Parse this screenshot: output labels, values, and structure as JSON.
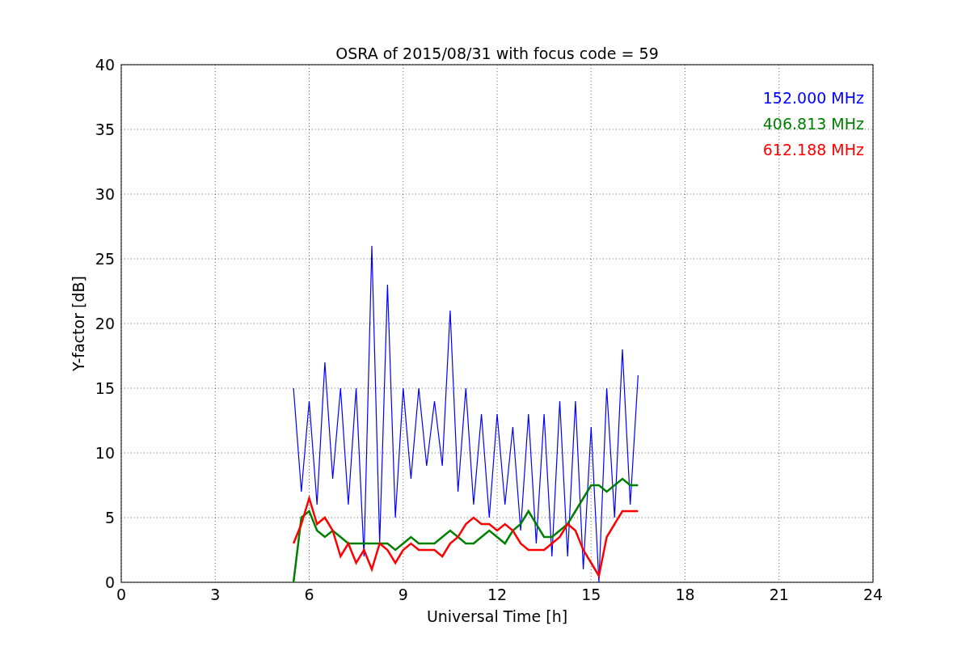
{
  "chart_data": {
    "type": "line",
    "title": "OSRA of 2015/08/31 with focus code = 59",
    "xlabel": "Universal Time [h]",
    "ylabel": "Y-factor [dB]",
    "x": [
      5.5,
      5.75,
      6,
      6.25,
      6.5,
      6.75,
      7,
      7.25,
      7.5,
      7.75,
      8,
      8.25,
      8.5,
      8.75,
      9,
      9.25,
      9.5,
      9.75,
      10,
      10.25,
      10.5,
      10.75,
      11,
      11.25,
      11.5,
      11.75,
      12,
      12.25,
      12.5,
      12.75,
      13,
      13.25,
      13.5,
      13.75,
      14,
      14.25,
      14.5,
      14.75,
      15,
      15.25,
      15.5,
      15.75,
      16,
      16.25,
      16.5
    ],
    "series": [
      {
        "name": "152.000 MHz",
        "color": "#0000ff",
        "values": [
          15,
          7,
          14,
          6,
          17,
          8,
          15,
          6,
          15,
          2,
          26,
          3,
          23,
          5,
          15,
          8,
          15,
          9,
          14,
          9,
          21,
          7,
          15,
          6,
          13,
          5,
          13,
          6,
          12,
          4,
          13,
          3,
          13,
          2,
          14,
          2,
          14,
          1,
          12,
          0,
          15,
          5,
          18,
          6,
          16
        ]
      },
      {
        "name": "406.813 MHz",
        "color": "#008000",
        "values": [
          0,
          5,
          5.5,
          4,
          3.5,
          4,
          3.5,
          3,
          3,
          3,
          3,
          3,
          3,
          2.5,
          3,
          3.5,
          3,
          3,
          3,
          3.5,
          4,
          3.5,
          3,
          3,
          3.5,
          4,
          3.5,
          3,
          4,
          4.5,
          5.5,
          4.5,
          3.5,
          3.5,
          4,
          4.5,
          5.5,
          6.5,
          7.5,
          7.5,
          7,
          7.5,
          8,
          7.5,
          7.5
        ]
      },
      {
        "name": "612.188 MHz",
        "color": "#ff0000",
        "values": [
          3,
          4.5,
          6.5,
          4.5,
          5,
          4,
          2,
          3,
          1.5,
          2.5,
          1,
          3,
          2.5,
          1.5,
          2.5,
          3,
          2.5,
          2.5,
          2.5,
          2,
          3,
          3.5,
          4.5,
          5,
          4.5,
          4.5,
          4,
          4.5,
          4,
          3,
          2.5,
          2.5,
          2.5,
          3,
          3.5,
          4.5,
          4,
          2.5,
          1.5,
          0.5,
          3.5,
          4.5,
          5.5,
          5.5,
          5.5
        ]
      }
    ],
    "grid": true,
    "xlim": [
      0,
      24
    ],
    "ylim": [
      0,
      40
    ],
    "xticks": [
      0,
      3,
      6,
      9,
      12,
      15,
      18,
      21,
      24
    ],
    "yticks": [
      0,
      5,
      10,
      15,
      20,
      25,
      30,
      35,
      40
    ]
  }
}
